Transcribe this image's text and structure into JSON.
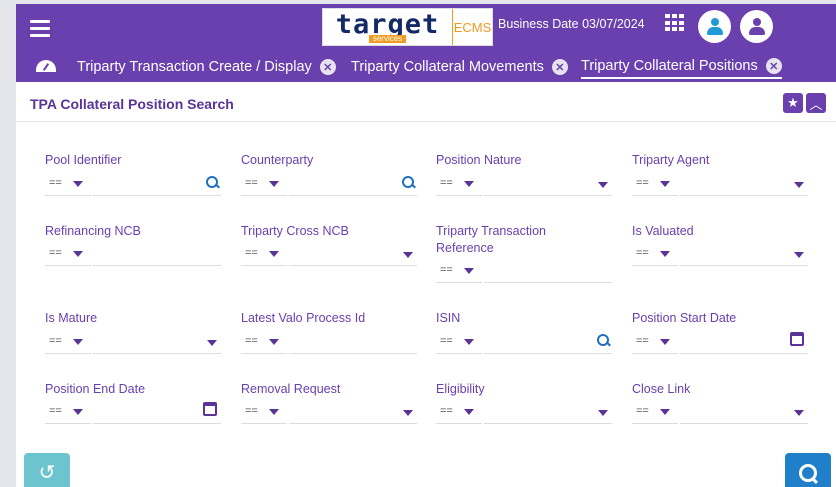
{
  "header": {
    "brand_logo": "target",
    "brand_sub": "services",
    "brand_ecms": "ECMS",
    "business_date": "Business Date 03/07/2024",
    "icons": [
      "menu-icon",
      "apps-grid-icon",
      "user-avatar-icon",
      "account-icon"
    ]
  },
  "tabs": [
    {
      "label": "Triparty Transaction Create / Display"
    },
    {
      "label": "Triparty Collateral Movements"
    },
    {
      "label": "Triparty Collateral Positions"
    }
  ],
  "panel": {
    "title": "TPA Collateral Position Search"
  },
  "operators": {
    "eq": "=="
  },
  "fields": [
    {
      "label": "Pool Identifier",
      "type": "search"
    },
    {
      "label": "Counterparty",
      "type": "search"
    },
    {
      "label": "Position Nature",
      "type": "select"
    },
    {
      "label": "Triparty Agent",
      "type": "select"
    },
    {
      "label": "Refinancing NCB",
      "type": "text"
    },
    {
      "label": "Triparty Cross NCB",
      "type": "select"
    },
    {
      "label": "Triparty Transaction Reference",
      "type": "text"
    },
    {
      "label": "Is Valuated",
      "type": "select"
    },
    {
      "label": "Is Mature",
      "type": "select"
    },
    {
      "label": "Latest Valo Process Id",
      "type": "text"
    },
    {
      "label": "ISIN",
      "type": "search"
    },
    {
      "label": "Position Start Date",
      "type": "date"
    },
    {
      "label": "Position End Date",
      "type": "date"
    },
    {
      "label": "Removal Request",
      "type": "select"
    },
    {
      "label": "Eligibility",
      "type": "select"
    },
    {
      "label": "Close Link",
      "type": "select"
    }
  ],
  "colors": {
    "primary": "#6a3fae",
    "accent": "#1f7fc9",
    "reset": "#6cc4cf",
    "brand_orange": "#f39a1f"
  }
}
